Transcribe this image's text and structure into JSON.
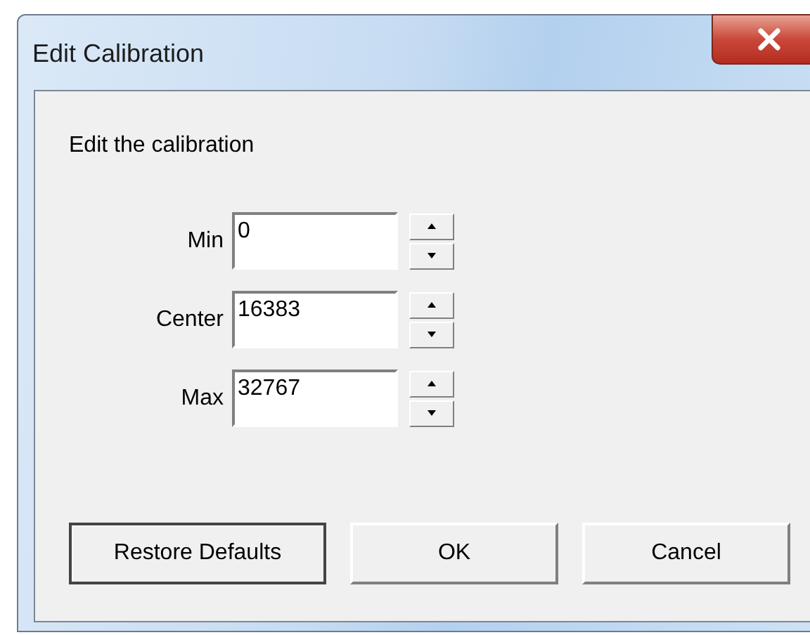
{
  "window": {
    "title": "Edit Calibration"
  },
  "instruction": "Edit the calibration",
  "fields": [
    {
      "label": "Min",
      "value": "0"
    },
    {
      "label": "Center",
      "value": "16383"
    },
    {
      "label": "Max",
      "value": "32767"
    }
  ],
  "buttons": [
    {
      "label": "Restore Defaults",
      "kind": "default"
    },
    {
      "label": "OK",
      "kind": "normal"
    },
    {
      "label": "Cancel",
      "kind": "normal"
    }
  ]
}
